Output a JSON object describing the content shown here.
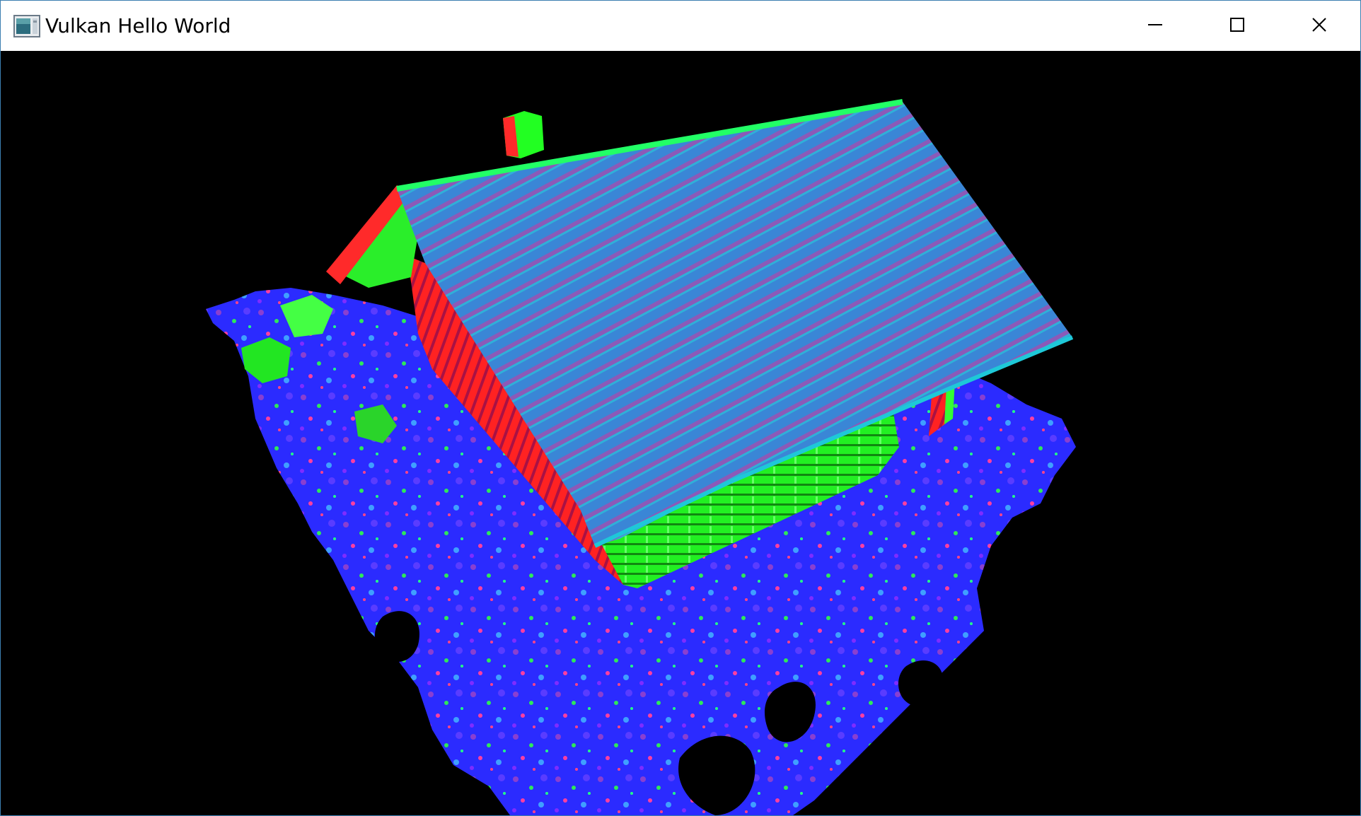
{
  "window": {
    "title": "Vulkan Hello World",
    "icons": {
      "app": "vulkan-app-icon",
      "minimize": "minimize-icon",
      "maximize": "maximize-icon",
      "close": "close-icon"
    },
    "colors": {
      "border": "#3c7fb1",
      "titlebar": "#ffffff",
      "background": "#000000"
    }
  },
  "scene": {
    "description_palette": {
      "roof": "#3a86d6",
      "ground": "#2a2aff",
      "wall_green": "#22ff22",
      "wall_red": "#ff2222"
    }
  }
}
